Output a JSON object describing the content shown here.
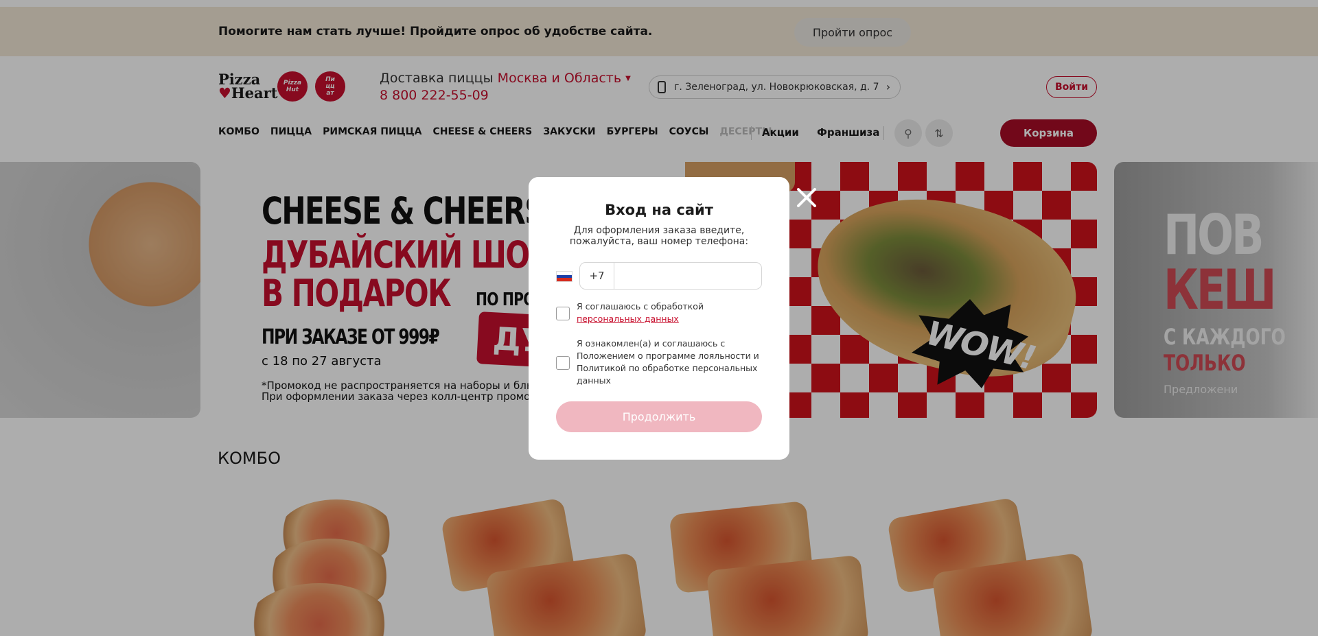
{
  "survey": {
    "text": "Помогите нам стать лучше! Пройдите опрос об удобстве сайта.",
    "button": "Пройти опрос"
  },
  "header": {
    "logo_line1": "Pizza",
    "logo_line2": "Heart",
    "delivery_label": "Доставка пиццы",
    "city": "Москва и Область",
    "phone": "8 800 222-55-09",
    "address": "г. Зеленоград, ул. Новокрюковская, д. 7",
    "login": "Войти"
  },
  "nav": {
    "items": [
      "КОМБО",
      "ПИЦЦА",
      "РИМСКАЯ ПИЦЦА",
      "CHEESE & CHEERS",
      "ЗАКУСКИ",
      "БУРГЕРЫ",
      "СОУСЫ",
      "ДЕСЕРТЫ"
    ],
    "promo": "Акции",
    "franchise": "Франшиза",
    "cart": "Корзина"
  },
  "banner": {
    "title1": "CHEESE & CHEERS",
    "title2": "ДУБАЙСКИЙ ШОКОЛАД",
    "title3": "В ПОДАРОК",
    "subtitle": "ПРИ ЗАКАЗЕ ОТ 999₽",
    "dates": "с 18 по 27 августа",
    "fine1": "*Промокод не распространяется на наборы и блюда по",
    "fine2": "При оформлении заказа через колл-центр промокод не",
    "promo_label": "ПО ПРО",
    "promo_code": "ДУ",
    "sticker": "WOW!"
  },
  "right_banner": {
    "t1": "ПОВ",
    "t2": "КЕШ",
    "t3": "С КАЖДОГО",
    "t4": "ТОЛЬКО",
    "t5": "Предложени"
  },
  "section": {
    "title": "КОМБО"
  },
  "modal": {
    "title": "Вход на сайт",
    "subtitle": "Для оформления заказа введите, пожалуйста, ваш номер телефона:",
    "country_code": "+7",
    "phone_value": "",
    "checkbox1_text": "Я соглашаюсь с обработкой ",
    "checkbox1_link": "персональных данных",
    "checkbox2_text": "Я ознакомлен(а) и соглашаюсь с Положением о программе лояльности и Политикой по обработке персональных данных",
    "continue": "Продолжить"
  },
  "colors": {
    "brand_red": "#c8102e",
    "cart_red": "#a80d27",
    "survey_bg": "#f2e7d6",
    "disabled_button": "#f0b7c0"
  },
  "icons": [
    "phone-icon",
    "chevron-right-icon",
    "search-icon",
    "sort-icon",
    "close-icon",
    "flag-ru-icon"
  ]
}
